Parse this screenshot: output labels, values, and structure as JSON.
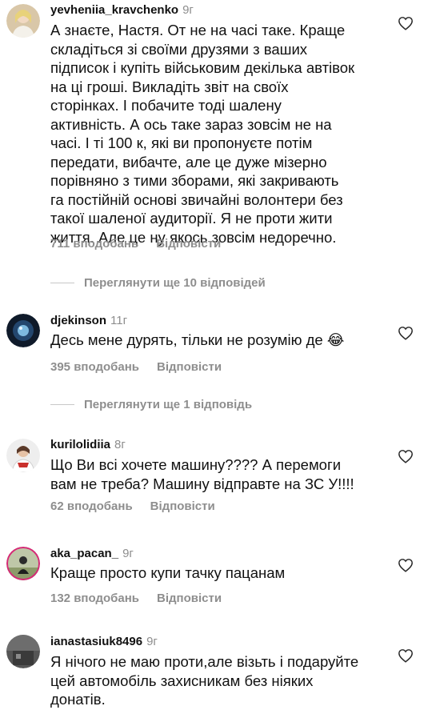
{
  "colors": {
    "text": "#111111",
    "secondary": "#8e8e8e",
    "divider": "#c7c7c7",
    "background": "#ffffff"
  },
  "comments": [
    {
      "username": "yevheniia_kravchenko",
      "age": "9г",
      "lines": [
        "А знаєте, Настя. От не на часі таке. Краще",
        "складіться зі своїми друзями з ваших",
        "підписок і купіть військовим декілька автівок",
        "на ці гроші. Викладіть звіт на своїх",
        "сторінках. І побачите тоді шалену",
        "активність. А ось таке зараз зовсім не на",
        "часі. І ті 100 к, які ви пропонуєте потім",
        "передати, вибачте, але це дуже мізерно",
        "порівняно з тими зборами, які закривають",
        "га постійній основі звичайні волонтери без",
        "такої шаленої аудиторії. Я не проти жити",
        "життя. Але це ну якось зовсім недоречно."
      ],
      "likes": "711 вподобань",
      "reply_label": "Відповісти",
      "like_icon": "heart-outline-icon"
    },
    {
      "username": "djekinson",
      "age": "11г",
      "lines": [
        "Десь мене дурять, тільки не розумію де 😂"
      ],
      "likes": "395 вподобань",
      "reply_label": "Відповісти",
      "like_icon": "heart-outline-icon"
    },
    {
      "username": "kurilolidiia",
      "age": "8г",
      "lines": [
        "Що Ви всі хочете машину???? А перемоги",
        "вам не треба? Машину відправте на ЗС У!!!!"
      ],
      "likes": "62 вподобань",
      "reply_label": "Відповісти",
      "like_icon": "heart-outline-icon"
    },
    {
      "username": "aka_pacan_",
      "age": "9г",
      "lines": [
        "Краще просто купи тачку пацанам"
      ],
      "likes": "132 вподобань",
      "reply_label": "Відповісти",
      "like_icon": "heart-outline-icon"
    },
    {
      "username": "ianastasiuk8496",
      "age": "9г",
      "lines": [
        "Я нічого не маю проти,але візьть і подаруйте",
        "цей автомобіль захисникам без ніяких",
        "донатів."
      ],
      "like_icon": "heart-outline-icon"
    }
  ],
  "view_replies": [
    {
      "label": "Переглянути ще 10 відповідей"
    },
    {
      "label": "Переглянути ще 1 відповідь"
    }
  ]
}
